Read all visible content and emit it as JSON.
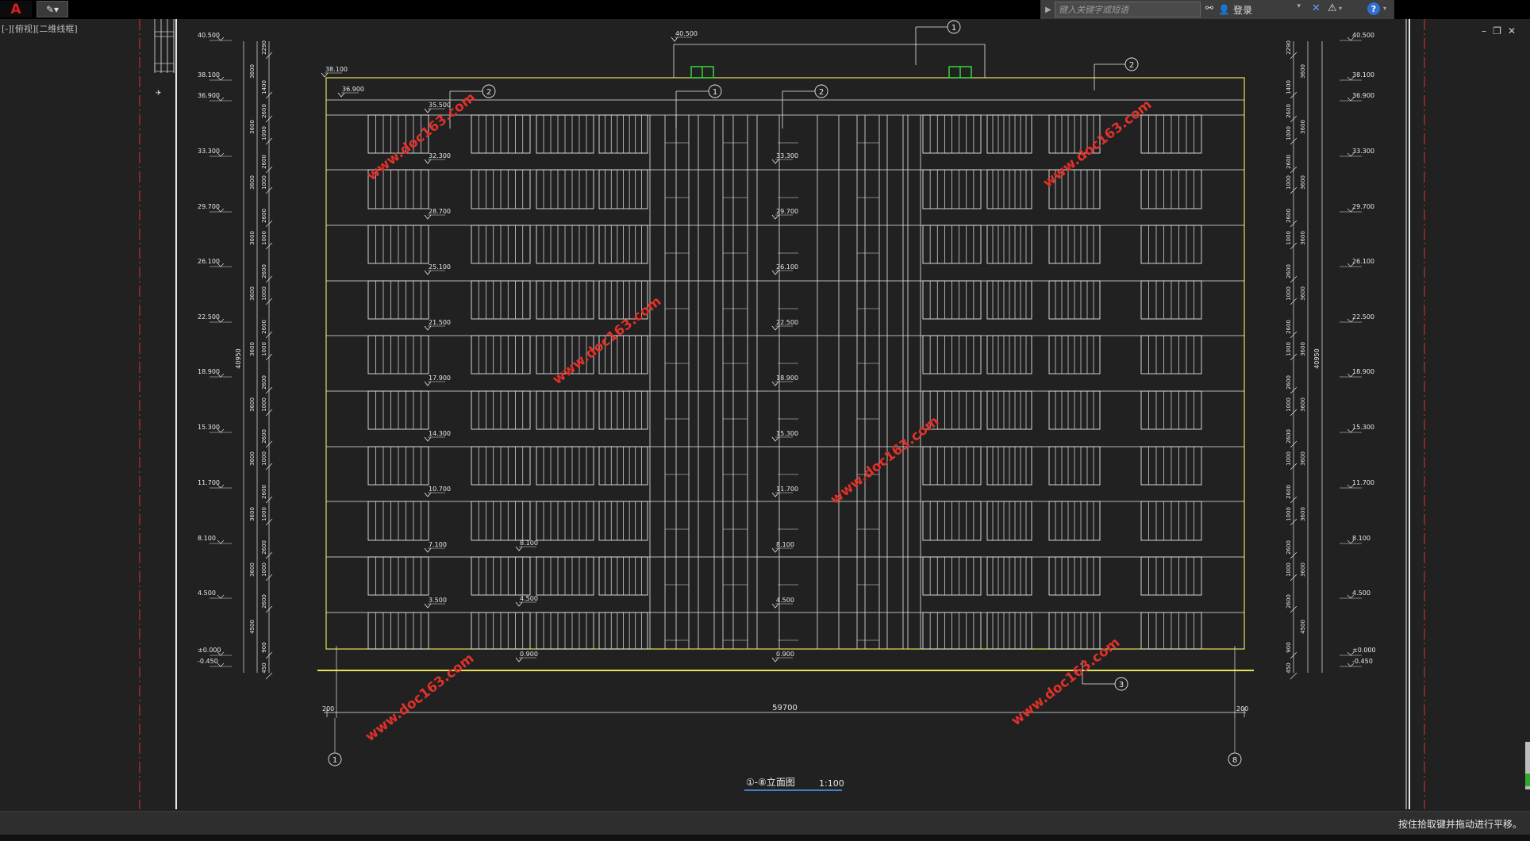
{
  "toolbar": {
    "app_logo": "A",
    "search_placeholder": "键入关键字或短语",
    "login_label": "登录"
  },
  "viewport": {
    "label": "[-][俯视][二维线框]"
  },
  "status": {
    "message": "按住拾取键并拖动进行平移。"
  },
  "drawing": {
    "title": "①-⑧立面图",
    "scale": "1:100",
    "total_width": "59700",
    "end_dim_left": "200",
    "end_dim_right": "200",
    "axis_left": "1",
    "axis_right": "8",
    "roof_top_level": "40.500",
    "parapet_level": "38.100",
    "roof_level": "36.900",
    "top_floor_left_label": "35.500",
    "callouts": [
      "1",
      "2",
      "3"
    ],
    "floor_levels_left": [
      "32.300",
      "28.700",
      "25.100",
      "21.500",
      "17.900",
      "14.300",
      "10.700",
      "7.100",
      "3.500"
    ],
    "floor_levels_center": [
      "33.300",
      "29.700",
      "26.100",
      "22.500",
      "18.900",
      "15.300",
      "11.700",
      "8.100",
      "4.500"
    ],
    "floor_levels_sub": [
      "8.100",
      "4.500",
      "0.900"
    ],
    "center_ground_level": "0.900",
    "left_scale_levels": [
      "40.500",
      "38.100",
      "36.900",
      "33.300",
      "29.700",
      "26.100",
      "22.500",
      "18.900",
      "15.300",
      "11.700",
      "8.100",
      "4.500",
      "±0.000",
      "-0.450"
    ],
    "right_scale_levels": [
      "40.500",
      "38.100",
      "36.900",
      "33.300",
      "29.700",
      "26.100",
      "22.500",
      "18.900",
      "15.300",
      "11.700",
      "8.100",
      "4.500",
      "±0.000",
      "-0.450"
    ],
    "dim_inner": [
      "2290",
      "1400",
      "2600",
      "1000",
      "2600",
      "1000",
      "2600",
      "1000",
      "2600",
      "1000",
      "2600",
      "1000",
      "2600",
      "1000",
      "2600",
      "1000",
      "2600",
      "1000",
      "2600",
      "1000",
      "2600",
      "900",
      "450"
    ],
    "dim_mid": [
      "3600",
      "3600",
      "3600",
      "3600",
      "3600",
      "3600",
      "3600",
      "3600",
      "3600",
      "3600",
      "4500"
    ],
    "overall_height": "40950",
    "watermark": "www.doc163.com"
  }
}
